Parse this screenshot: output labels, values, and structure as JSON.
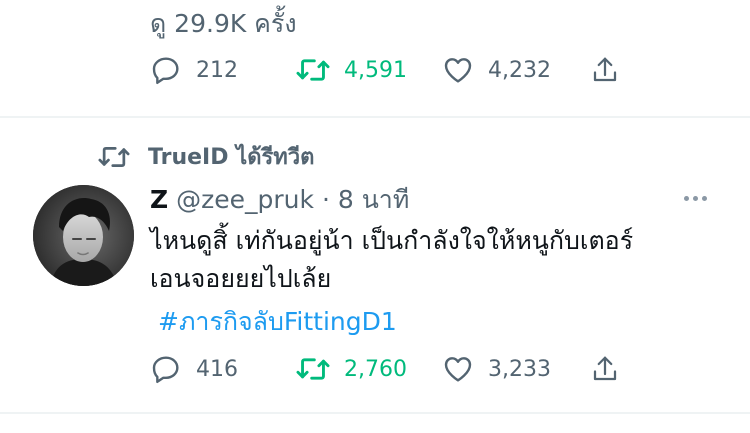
{
  "previous_tweet": {
    "views": "ดู 29.9K ครั้ง",
    "stats": {
      "replies": "212",
      "retweets": "4,591",
      "likes": "4,232"
    }
  },
  "retweet_header": {
    "text": "TrueID ได้รีทวีต"
  },
  "tweet": {
    "display_name": "Z",
    "handle": "@zee_pruk",
    "separator": "·",
    "time": "8 นาที",
    "text_line1": "ไหนดูสิ้ เท่กันอยู่น้า เป็นกำลังใจให้หนูกับเตอร์",
    "text_line2": "เอนจอยยยไปเล้ย",
    "hashtag": "#ภารกิจลับFittingD1",
    "stats": {
      "replies": "416",
      "retweets": "2,760",
      "likes": "3,233"
    }
  },
  "colors": {
    "text": "#0f1419",
    "secondary": "#536471",
    "retweet_green": "#00ba7c",
    "link_blue": "#1d9bf0",
    "divider": "#eff3f4"
  }
}
